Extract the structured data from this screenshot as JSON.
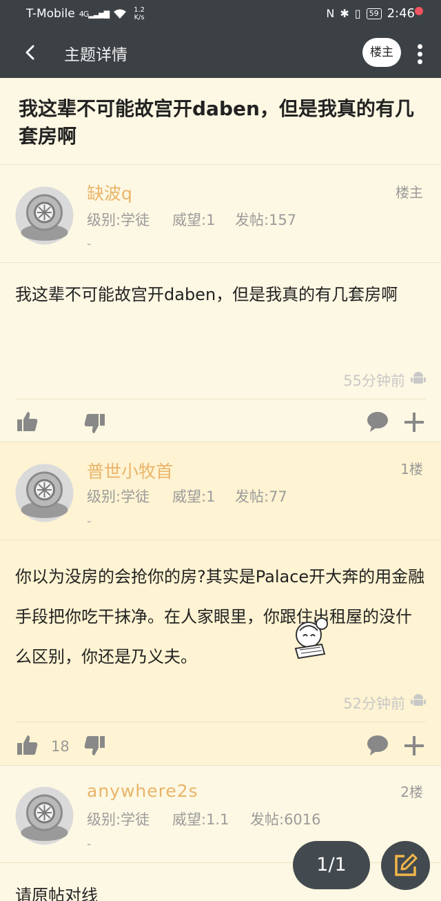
{
  "status_bar": {
    "carrier": "T-Mobile",
    "network": "4G",
    "speed_value": "1.2",
    "speed_unit": "K/s",
    "battery": "59",
    "time": "2:46"
  },
  "toolbar": {
    "title": "主题详情",
    "op_button": "楼主"
  },
  "topic": {
    "title": "我这辈不可能故宫开daben，但是我真的有几套房啊"
  },
  "posts": [
    {
      "author": "缺波q",
      "floor": "楼主",
      "level_label": "级别:学徒",
      "prestige_label": "威望:1",
      "posts_label": "发帖:157",
      "dash": "-",
      "content": "我这辈不可能故宫开daben，但是我真的有几套房啊",
      "time": "55分钟前",
      "likes": ""
    },
    {
      "author": "普世小牧首",
      "floor": "1楼",
      "level_label": "级别:学徒",
      "prestige_label": "威望:1",
      "posts_label": "发帖:77",
      "dash": "-",
      "content": "你以为没房的会抢你的房?其实是Palace开大奔的用金融手段把你吃干抹净。在人家眼里，你跟住出租屋的没什么区别，你还是乃义夫。",
      "time": "52分钟前",
      "likes": "18"
    },
    {
      "author": "anywhere2s",
      "floor": "2楼",
      "level_label": "级别:学徒",
      "prestige_label": "威望:1.1",
      "posts_label": "发帖:6016",
      "dash": "-",
      "content": "请原帖对线",
      "time": "",
      "likes": ""
    }
  ],
  "page_indicator": "1/1",
  "colors": {
    "bar": "#3b4145",
    "page_bg": "#fdf8e3",
    "alt_bg": "#fef3d2",
    "author": "#e9b46a",
    "red_dot": "#f0545f"
  }
}
